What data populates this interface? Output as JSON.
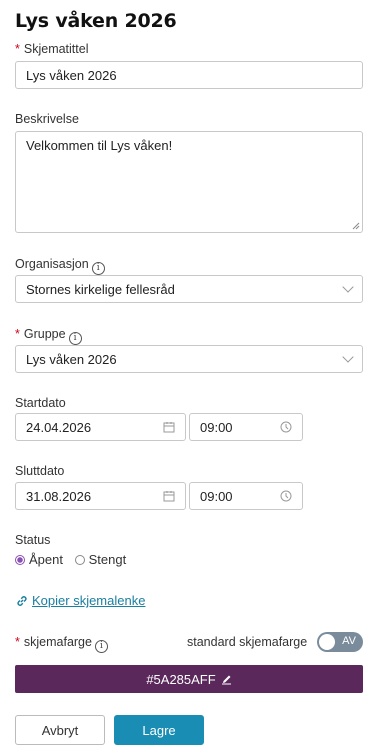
{
  "form": {
    "title": "Lys våken 2026",
    "schema_title": {
      "label": "Skjematittel",
      "required_mark": "*",
      "value": "Lys våken 2026"
    },
    "description": {
      "label": "Beskrivelse",
      "value": "Velkommen til Lys våken!"
    },
    "organization": {
      "label": "Organisasjon",
      "info_glyph": "i",
      "value": "Stornes kirkelige fellesråd"
    },
    "group": {
      "label": "Gruppe",
      "required_mark": "*",
      "info_glyph": "i",
      "value": "Lys våken 2026"
    },
    "start": {
      "label": "Startdato",
      "date": "24.04.2026",
      "time": "09:00"
    },
    "end": {
      "label": "Sluttdato",
      "date": "31.08.2026",
      "time": "09:00"
    },
    "status": {
      "label": "Status",
      "options": [
        "Åpent",
        "Stengt"
      ],
      "selected": "Åpent"
    },
    "copy_link": {
      "label": "Kopier skjemalenke",
      "icon": "link-icon"
    },
    "schema_color": {
      "label": "skjemafarge",
      "required_mark": "*",
      "info_glyph": "i",
      "default_label": "standard skjemafarge",
      "toggle_text": "AV",
      "toggle_on": false,
      "value": "#5A285AFF",
      "color": "#5A285A",
      "edit_icon": "pencil-icon"
    },
    "buttons": {
      "cancel": "Avbryt",
      "save": "Lagre"
    }
  },
  "colors": {
    "accent": "#1a8db4",
    "required": "#d0021b",
    "radio_selected": "#8a4fb3"
  }
}
